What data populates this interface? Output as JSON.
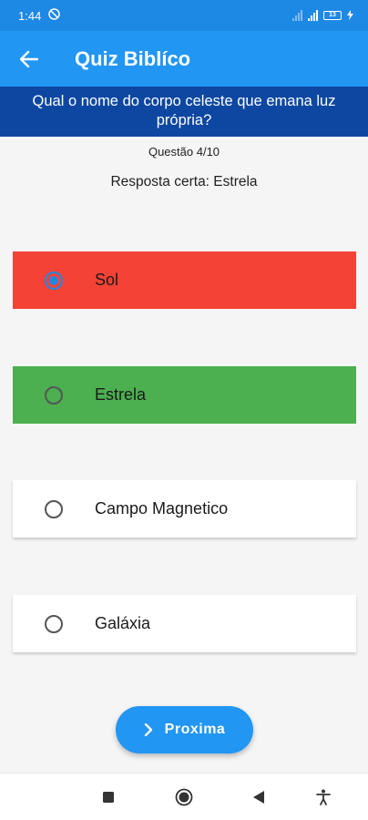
{
  "status_bar": {
    "time": "1:44",
    "battery": "13"
  },
  "app_bar": {
    "title": "Quiz Biblíco"
  },
  "question": {
    "text": "Qual o nome do corpo celeste que emana luz própria?"
  },
  "progress": {
    "label": "Questão 4/10"
  },
  "result": {
    "text": "Resposta certa: Estrela"
  },
  "options": [
    {
      "label": "Sol",
      "selected": true,
      "state": "wrong",
      "color": "#f44336"
    },
    {
      "label": "Estrela",
      "selected": false,
      "state": "correct",
      "color": "#4caf50"
    },
    {
      "label": "Campo Magnetico",
      "selected": false,
      "state": "neutral",
      "color": "#ffffff"
    },
    {
      "label": "Galáxia",
      "selected": false,
      "state": "neutral",
      "color": "#ffffff"
    }
  ],
  "next_button": {
    "label": "Proxima"
  },
  "nav_bar": {
    "icons": [
      "recents-icon",
      "home-icon",
      "back-icon",
      "accessibility-icon"
    ]
  },
  "colors": {
    "primary": "#2196f3",
    "status_bar": "#1e88e5",
    "question_bar": "#0d47a1",
    "radio_selected": "#1e88e5"
  }
}
